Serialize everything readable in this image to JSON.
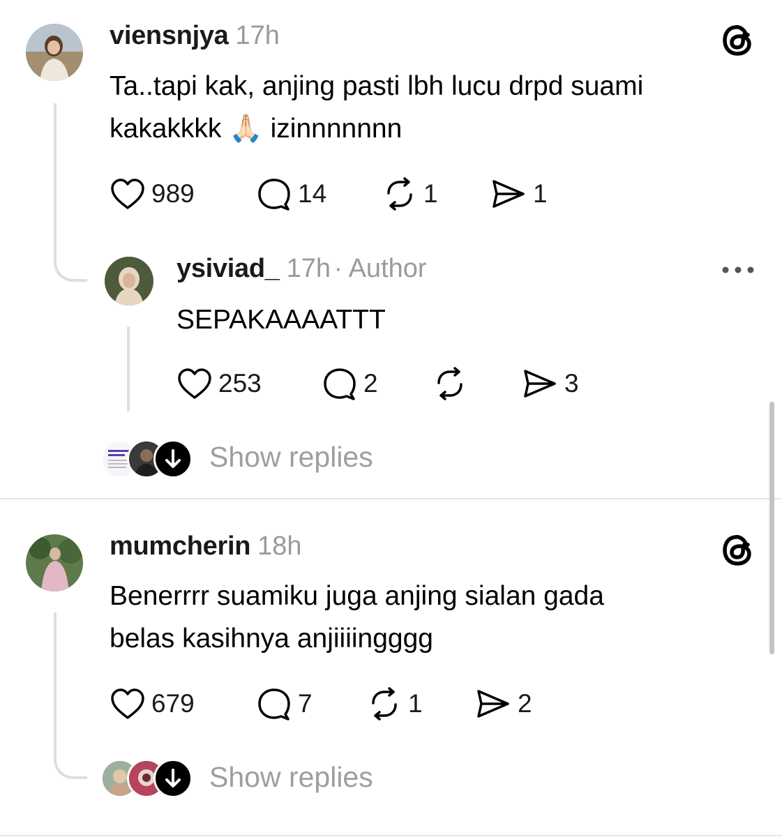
{
  "posts": [
    {
      "username": "viensnjya",
      "time": "17h",
      "text_line1": "Ta..tapi kak, anjing pasti lbh lucu drpd suami",
      "text_line2": "kakakkkk 🙏🏻 izinnnnnnn",
      "likes": "989",
      "replies": "14",
      "reposts": "1",
      "shares": "1"
    },
    {
      "username": "ysiviad_",
      "time": "17h",
      "author_label": "· Author",
      "text": "SEPAKAAAATTT",
      "likes": "253",
      "replies": "2",
      "reposts": "",
      "shares": "3"
    },
    {
      "username": "mumcherin",
      "time": "18h",
      "text_line1": "Benerrrr suamiku juga anjing sialan gada",
      "text_line2": "belas kasihnya anjiiiingggg",
      "likes": "679",
      "replies": "7",
      "reposts": "1",
      "shares": "2"
    }
  ],
  "show_replies_label": "Show replies",
  "colors": {
    "text": "#000000",
    "muted": "#9a9a9a",
    "thread_line": "#dedede",
    "divider": "#e6e6e6"
  },
  "icons": [
    "threads-logo-icon",
    "heart-icon",
    "comment-icon",
    "repost-icon",
    "share-icon",
    "more-icon",
    "arrow-down-icon"
  ]
}
